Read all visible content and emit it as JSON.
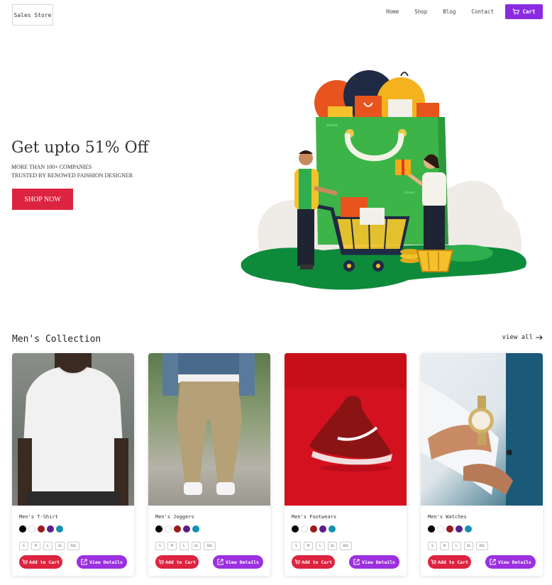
{
  "nav": {
    "logo": "Sales Store",
    "links": [
      "Home",
      "Shop",
      "Blog",
      "Contact"
    ],
    "cart_label": "Cart",
    "accent": "#8a2be2"
  },
  "hero": {
    "title": "Get upto 51% Off",
    "subtitle_line1": "MORE THAN 100+ COMPANIES",
    "subtitle_line2": "TRUSTED BY RENOWED FAISHION DESIGNER",
    "cta": "SHOP NOW",
    "illustration": "shopping-bag-illustration"
  },
  "collection": {
    "title": "Men's Collection",
    "view_all": "view all",
    "colors": [
      "#000000",
      "#ffffff",
      "#9b1b1b",
      "#5b1e8a",
      "#1491b0"
    ],
    "sizes": [
      "S",
      "M",
      "L",
      "XL",
      "XXL"
    ],
    "add_label": "Add to Cart",
    "view_label": "View Details",
    "products": [
      {
        "name": "Men's T-Shirt",
        "image": "white-tshirt-photo"
      },
      {
        "name": "Men's Joggers",
        "image": "joggers-photo"
      },
      {
        "name": "Men's Footwears",
        "image": "red-sneaker-photo"
      },
      {
        "name": "Men's Watches",
        "image": "watch-photo"
      }
    ]
  }
}
